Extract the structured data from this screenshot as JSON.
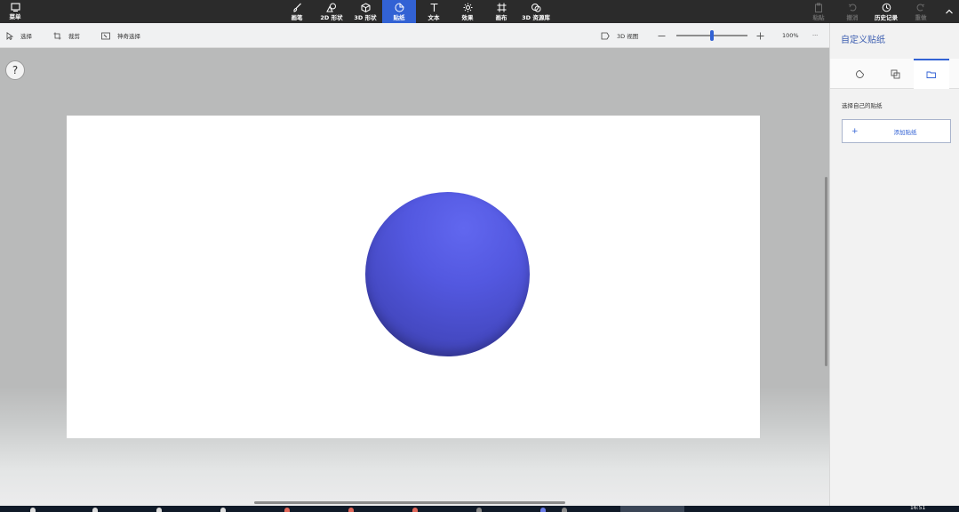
{
  "topbar": {
    "menu": "菜单",
    "tools": [
      {
        "id": "brushes",
        "label": "画笔",
        "icon": "brush-icon"
      },
      {
        "id": "shapes2d",
        "label": "2D 形状",
        "icon": "shapes-2d-icon"
      },
      {
        "id": "shapes3d",
        "label": "3D 形状",
        "icon": "cube-icon"
      },
      {
        "id": "stickers",
        "label": "贴纸",
        "icon": "sticker-icon",
        "active": true
      },
      {
        "id": "text",
        "label": "文本",
        "icon": "text-icon"
      },
      {
        "id": "effects",
        "label": "效果",
        "icon": "sun-icon"
      },
      {
        "id": "canvas",
        "label": "画布",
        "icon": "canvas-icon"
      },
      {
        "id": "library",
        "label": "3D 资源库",
        "icon": "library-icon"
      }
    ],
    "right": {
      "paste": "粘贴",
      "undo": "撤消",
      "history": "历史记录",
      "redo": "重做"
    }
  },
  "toolbar": {
    "select": "选择",
    "crop": "裁剪",
    "magic_select": "神奇选择",
    "view3d": "3D 视图",
    "zoom_value": 100,
    "zoom_label": "100%",
    "more": "···"
  },
  "help": "?",
  "panel": {
    "title": "自定义贴纸",
    "subtitle": "选择自己的贴纸",
    "add_label": "添加贴纸",
    "add_plus": "+"
  },
  "taskbar": {
    "time": "16:51"
  },
  "colors": {
    "accent": "#3262d4",
    "sphere": "#5358e0",
    "ribbon": "#2b2b2b"
  }
}
